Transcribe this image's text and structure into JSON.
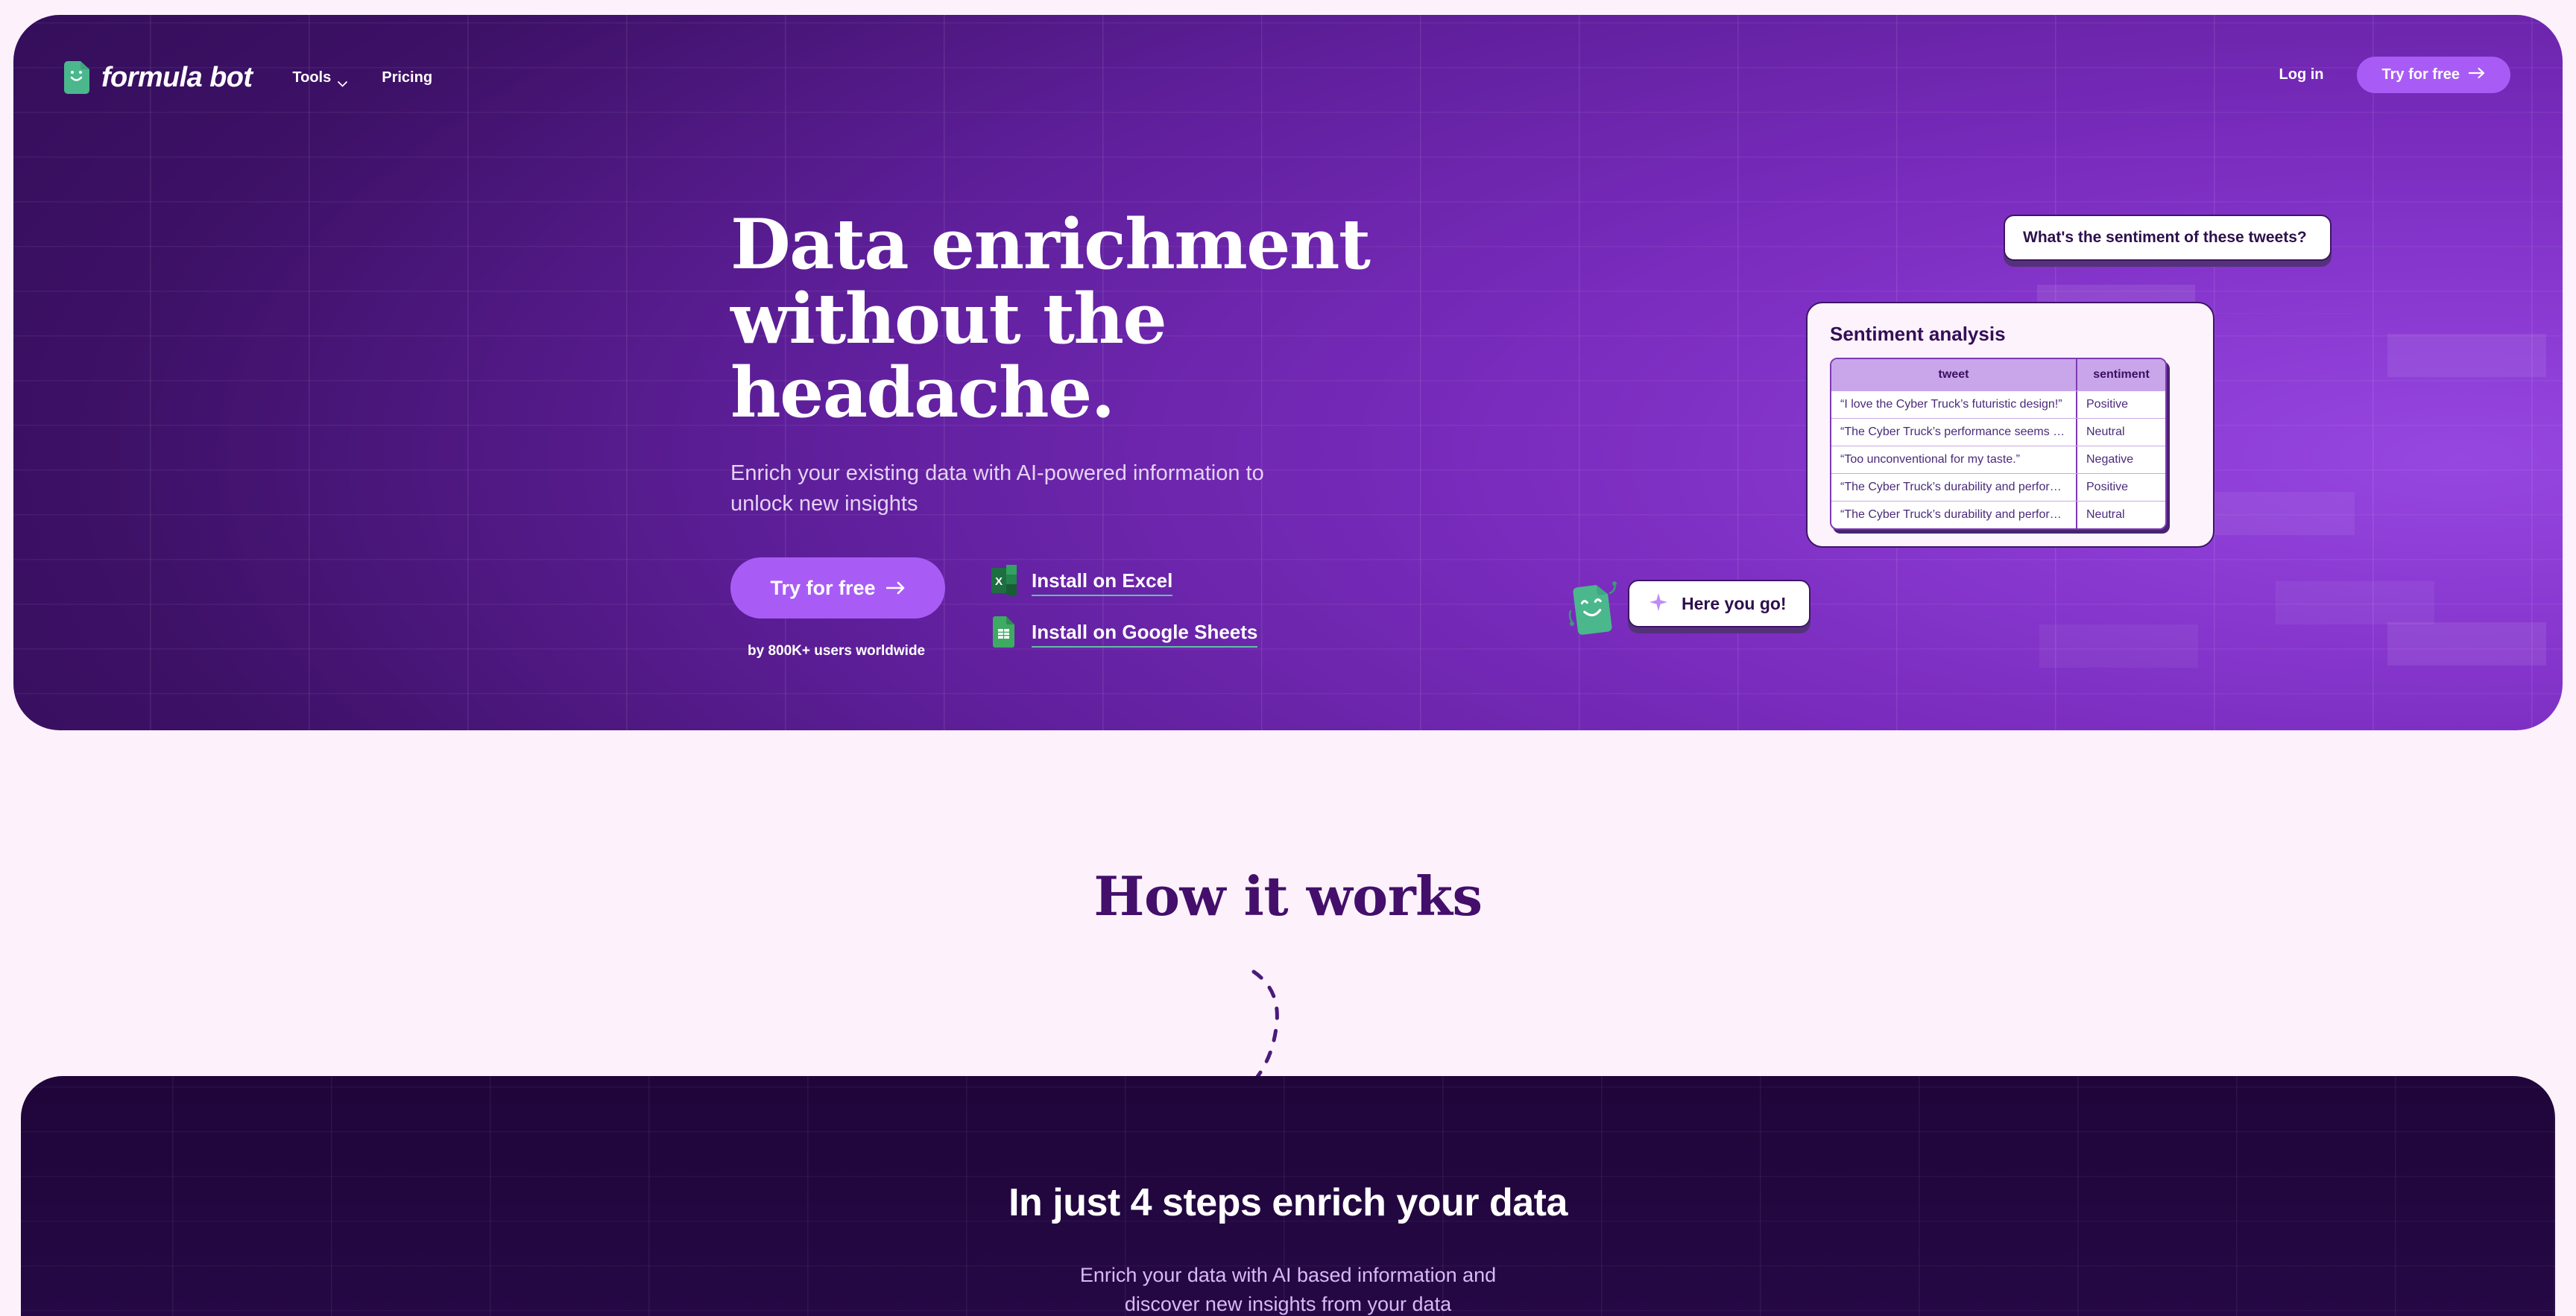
{
  "colors": {
    "page_bg": "#fdf2fb",
    "hero_dark": "#2b0b4f",
    "hero_light": "#9647e0",
    "accent_purple": "#a95cf5",
    "brand_green": "#4bb78d",
    "deep_purple_text": "#430f6b"
  },
  "nav": {
    "brand": "formula bot",
    "brand_icon": "green-sheet-smiley-icon",
    "links": [
      {
        "label": "Tools",
        "icon": "chevron-down-icon",
        "has_chevron": true
      },
      {
        "label": "Pricing",
        "has_chevron": false
      }
    ],
    "login_label": "Log in",
    "cta_label": "Try for free",
    "cta_icon": "arrow-right-icon"
  },
  "hero": {
    "headline_lines": [
      "Data enrichment",
      "without the",
      "headache."
    ],
    "headline": "Data enrichment without the headache.",
    "subhead": "Enrich your existing data with AI-powered information to unlock new insights",
    "cta_label": "Try for free",
    "cta_icon": "arrow-right-icon",
    "users_note": "by 800K+ users worldwide",
    "installs": [
      {
        "label": "Install on Excel",
        "icon": "excel-icon"
      },
      {
        "label": "Install on Google Sheets",
        "icon": "google-sheets-icon"
      }
    ]
  },
  "prompt_bubble": {
    "text": "What's the sentiment of these tweets?"
  },
  "assistant_bubble": {
    "text": "Here you go!",
    "icon": "sparkle-icon",
    "mascot": "green-sheet-mascot"
  },
  "sentiment_card": {
    "title": "Sentiment analysis",
    "columns": [
      "tweet",
      "sentiment"
    ],
    "rows": [
      {
        "tweet": "“I love the Cyber Truck’s futuristic design!”",
        "sentiment": "Positive"
      },
      {
        "tweet": "“The Cyber Truck’s performance seems decent”",
        "sentiment": "Neutral"
      },
      {
        "tweet": "“Too unconventional for my taste.”",
        "sentiment": "Negative"
      },
      {
        "tweet": "“The Cyber Truck’s durability and performance…",
        "sentiment": "Positive"
      },
      {
        "tweet": "“The Cyber Truck’s durability and performance",
        "sentiment": "Neutral"
      }
    ]
  },
  "how_it_works": {
    "title": "How it works",
    "connector": "dashed-curve"
  },
  "steps_section": {
    "title": "In just 4 steps enrich your data",
    "subtitle_lines": [
      "Enrich your data with AI based information and",
      "discover new insights from your data"
    ],
    "subtitle": "Enrich your data with AI based information and discover new insights from your data"
  }
}
